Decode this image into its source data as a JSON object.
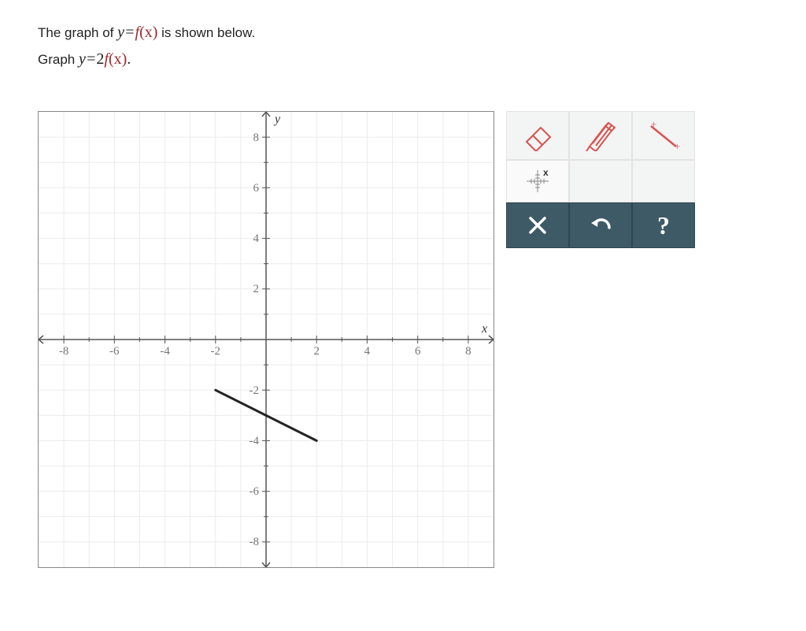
{
  "question": {
    "line1_prefix": "The graph of ",
    "line1_eq_y": "y",
    "line1_eq_eq": "=",
    "line1_eq_f": "f",
    "line1_eq_paren_x": "(x)",
    "line1_suffix": " is shown below.",
    "line2_prefix": "Graph ",
    "line2_eq_y": "y",
    "line2_eq_eq": "=",
    "line2_eq_coef": "2",
    "line2_eq_f": "f",
    "line2_eq_paren_x": "(x)",
    "line2_period": "."
  },
  "axes": {
    "x_label": "x",
    "y_label": "y",
    "x_ticks": [
      "-8",
      "-6",
      "-4",
      "-2",
      "2",
      "4",
      "6",
      "8"
    ],
    "y_ticks": [
      "8",
      "6",
      "4",
      "2",
      "-2",
      "-4",
      "-6",
      "-8"
    ]
  },
  "chart_data": {
    "type": "line",
    "title": "",
    "xlabel": "x",
    "ylabel": "y",
    "xlim": [
      -9,
      9
    ],
    "ylim": [
      -9,
      9
    ],
    "grid": true,
    "series": [
      {
        "name": "f(x)",
        "points": [
          [
            -2,
            -2
          ],
          [
            2,
            -4
          ]
        ]
      }
    ]
  },
  "tools": {
    "eraser": "eraser-icon",
    "pencil": "pencil-icon",
    "segment": "segment-icon",
    "point": "point-icon",
    "clear": "×",
    "undo": "↶",
    "help": "?"
  }
}
